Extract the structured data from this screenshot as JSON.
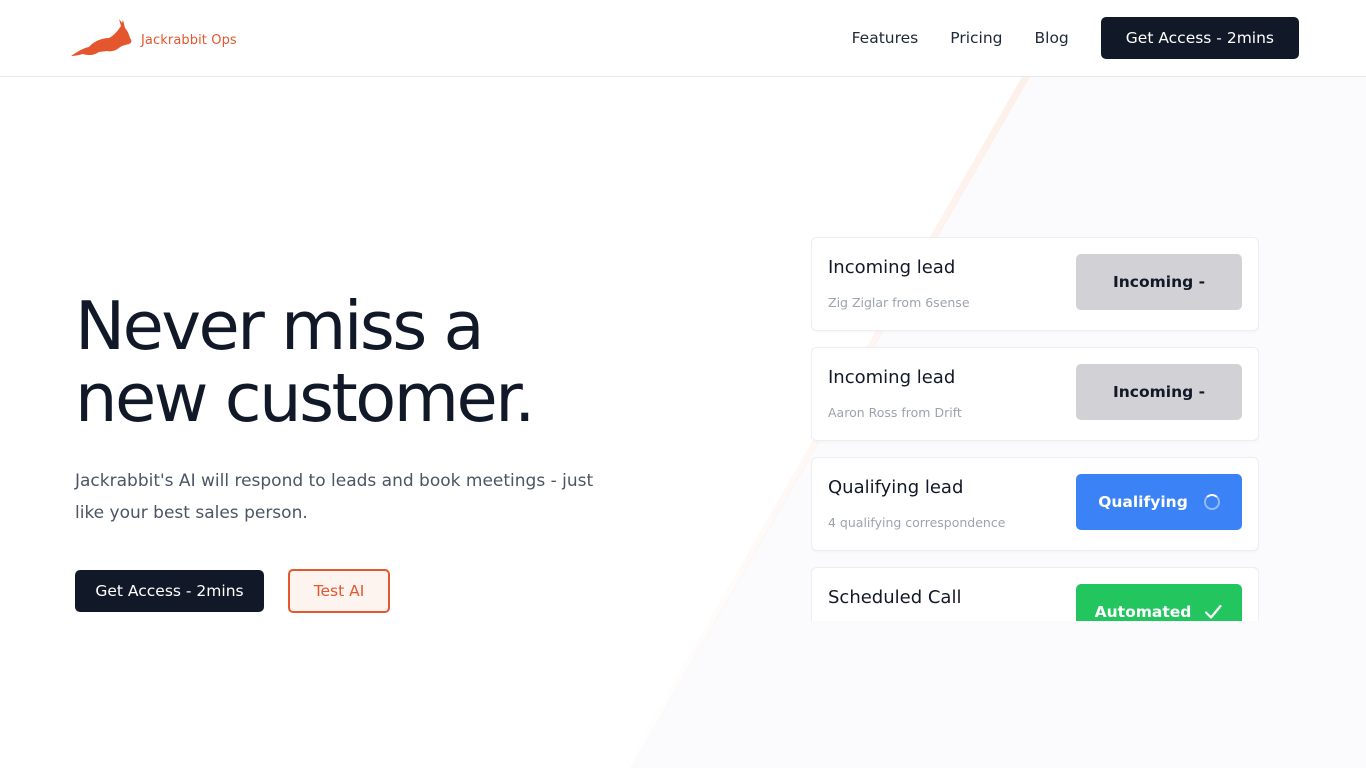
{
  "header": {
    "logo_text": "Jackrabbit Ops",
    "nav": {
      "features": "Features",
      "pricing": "Pricing",
      "blog": "Blog"
    },
    "cta_label": "Get Access - 2mins"
  },
  "hero": {
    "headline_line1": "Never miss a",
    "headline_line2": "new customer.",
    "subtext": "Jackrabbit's AI will respond to leads and book meetings - just like your best sales person.",
    "primary_cta": "Get Access - 2mins",
    "secondary_cta": "Test AI"
  },
  "cards": [
    {
      "title": "Incoming lead",
      "subtitle": "Zig Ziglar from 6sense",
      "status": "Incoming -",
      "status_type": "incoming"
    },
    {
      "title": "Incoming lead",
      "subtitle": "Aaron Ross from Drift",
      "status": "Incoming -",
      "status_type": "incoming"
    },
    {
      "title": "Qualifying lead",
      "subtitle": "4 qualifying correspondence",
      "status": "Qualifying",
      "status_type": "qualifying"
    },
    {
      "title": "Scheduled Call",
      "subtitle": "",
      "status": "Automated",
      "status_type": "automated"
    }
  ],
  "colors": {
    "brand": "#e4572e",
    "dark": "#111827",
    "incoming": "#d1d1d6",
    "qualifying": "#3b82f6",
    "automated": "#22c55e"
  },
  "icons": {
    "logo": "rabbit-logo-icon",
    "spinner": "spinner-icon",
    "check": "check-icon"
  }
}
